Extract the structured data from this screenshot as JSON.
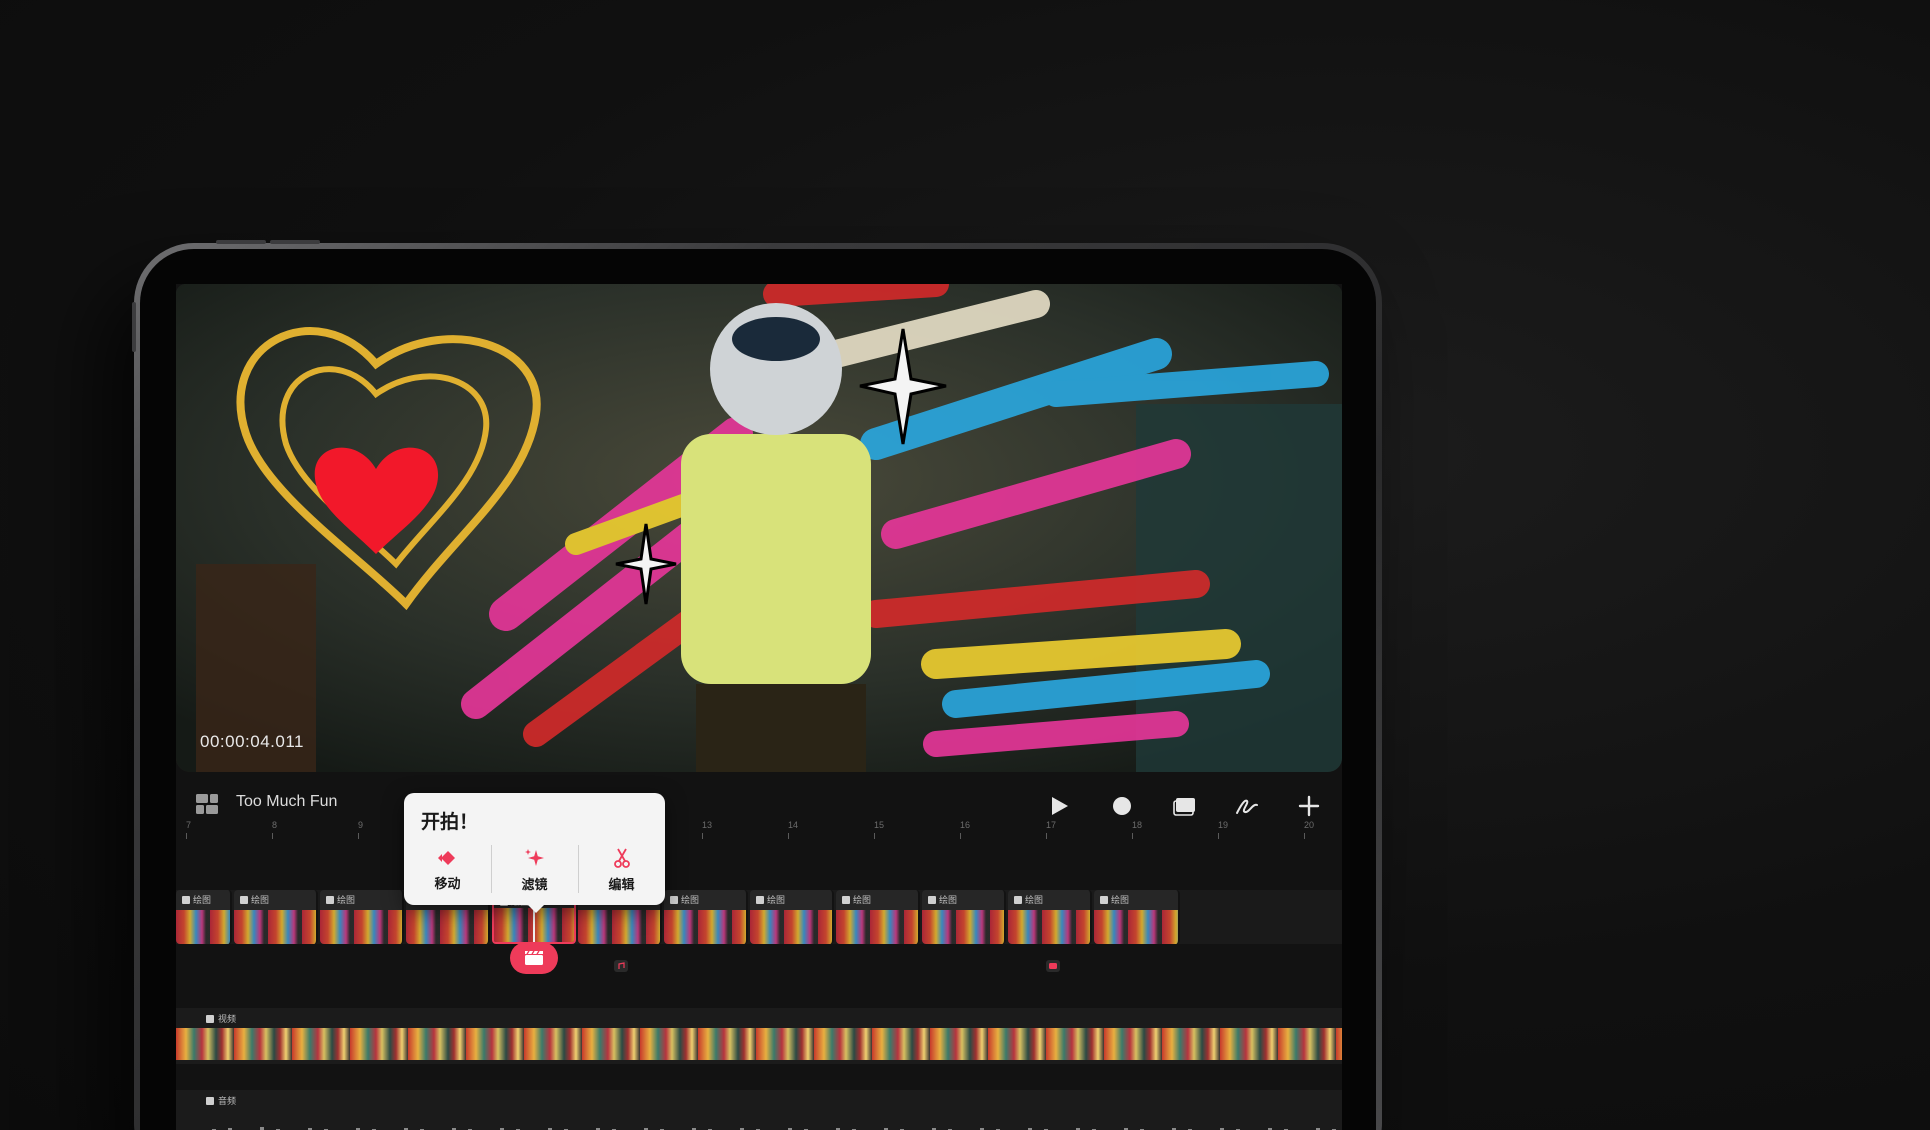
{
  "app": {
    "project_title": "Too Much Fun",
    "timecode": "00:00:04.011"
  },
  "toolbar": {
    "buttons": [
      {
        "name": "play",
        "icon": "play-icon"
      },
      {
        "name": "record",
        "icon": "record-icon"
      },
      {
        "name": "layers",
        "icon": "layers-icon"
      },
      {
        "name": "draw",
        "icon": "draw-icon"
      },
      {
        "name": "add",
        "icon": "plus-icon"
      }
    ]
  },
  "ruler": {
    "ticks": [
      "7",
      "8",
      "9",
      "13",
      "14",
      "15",
      "16",
      "17",
      "18",
      "19",
      "20"
    ]
  },
  "tracks": {
    "drawing_label": "绘图",
    "video_label": "视频",
    "audio_label": "音频"
  },
  "popover": {
    "title": "开拍！",
    "actions": [
      {
        "label": "移动",
        "icon": "move-icon"
      },
      {
        "label": "滤镜",
        "icon": "sparkle-icon"
      },
      {
        "label": "编辑",
        "icon": "scissors-icon"
      }
    ]
  },
  "colors": {
    "accent": "#ee3b5a",
    "background": "#0f0f0f",
    "screen": "#121212"
  }
}
